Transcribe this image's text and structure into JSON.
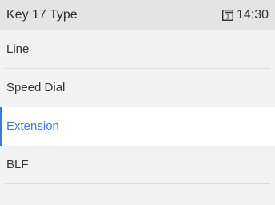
{
  "header": {
    "title": "Key 17 Type",
    "line_icon_number": "1",
    "time": "14:30"
  },
  "menu": {
    "items": [
      {
        "label": "Line"
      },
      {
        "label": "Speed Dial"
      },
      {
        "label": "Extension"
      },
      {
        "label": "BLF"
      }
    ],
    "selected_label": "Extension"
  },
  "colors": {
    "accent": "#3a7bd5",
    "header_bg": "#e4e4e4",
    "list_bg": "#f2f2f2",
    "selected_bg": "#ffffff"
  },
  "icons": {
    "line": "line-indicator-icon"
  }
}
